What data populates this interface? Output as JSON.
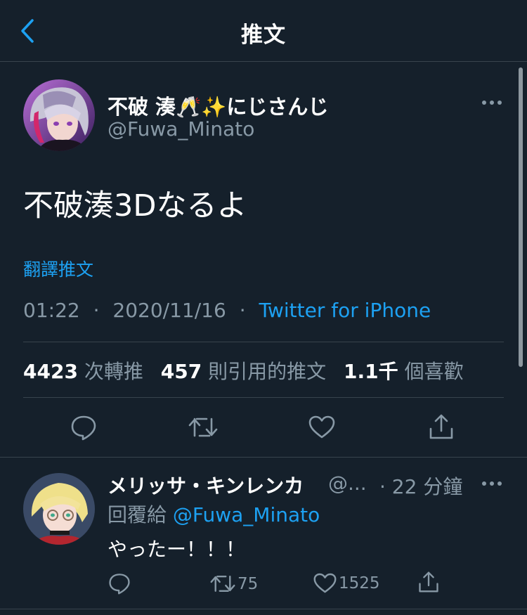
{
  "nav": {
    "title": "推文",
    "back_icon": "chevron-left-icon"
  },
  "tweet": {
    "display_name": "不破 湊🥂✨にじさんじ",
    "handle": "@Fuwa_Minato",
    "text": "不破湊3Dなるよ",
    "translate_label": "翻譯推文",
    "time": "01:22",
    "dot1": "·",
    "date": "2020/11/16",
    "dot2": "·",
    "source": "Twitter for iPhone",
    "stats": {
      "retweets_count": "4423",
      "retweets_label": "次轉推",
      "quotes_count": "457",
      "quotes_label": "則引用的推文",
      "likes_count": "1.1千",
      "likes_label": "個喜歡"
    },
    "actions": [
      "reply-icon",
      "retweet-icon",
      "like-icon",
      "share-icon"
    ]
  },
  "reply": {
    "display_name": "メリッサ・キンレンカ",
    "handle": "@...",
    "time": "· 22 分鐘",
    "replying_to_label": "回覆給",
    "replying_to_handle": "@Fuwa_Minato",
    "text": "やったー！！！",
    "retweet_count": "75",
    "like_count": "1525"
  },
  "colors": {
    "background": "#15202b",
    "divider": "#38444d",
    "secondary_text": "#8899a6",
    "accent": "#1da1f2"
  }
}
